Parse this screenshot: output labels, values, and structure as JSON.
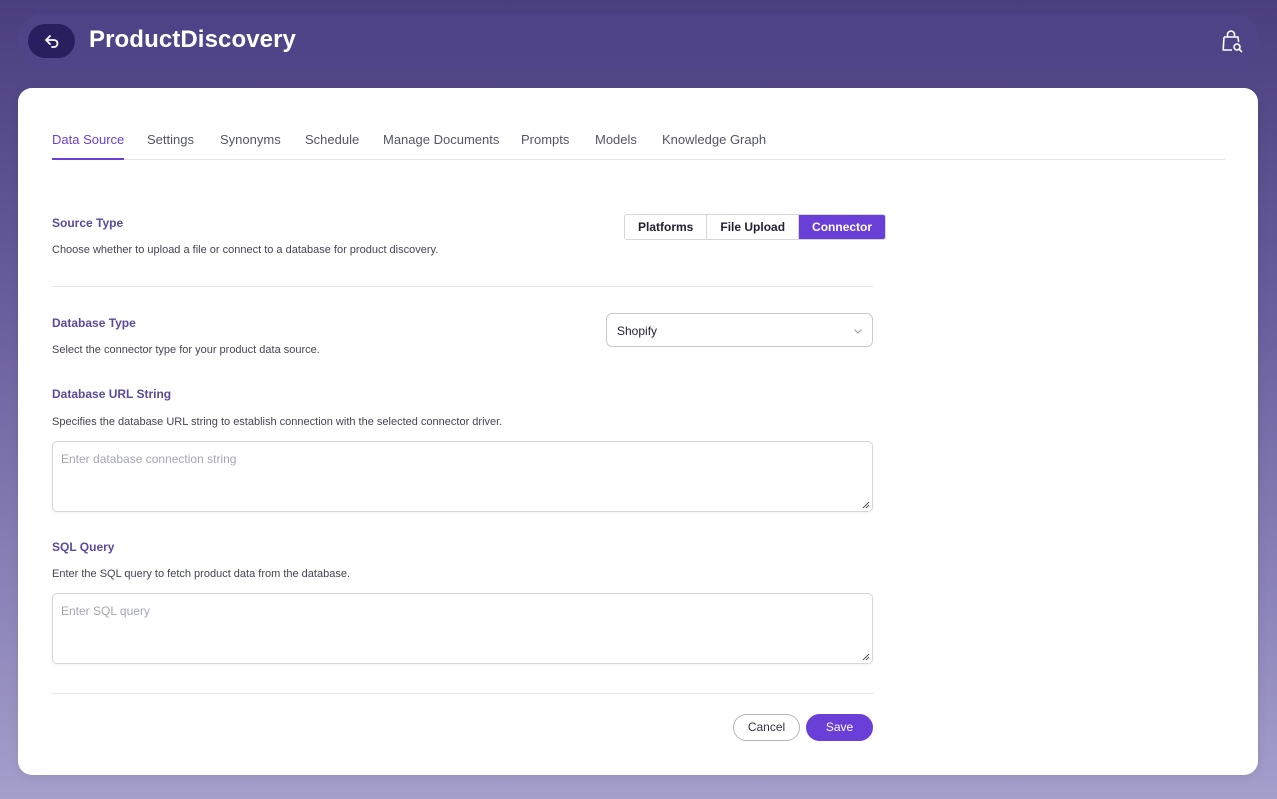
{
  "header": {
    "title": "ProductDiscovery",
    "back_icon": "undo-arrow-icon",
    "right_icon": "shopping-bag-search-icon"
  },
  "tabs": [
    {
      "label": "Data Source",
      "active": true
    },
    {
      "label": "Settings",
      "active": false
    },
    {
      "label": "Synonyms",
      "active": false
    },
    {
      "label": "Schedule",
      "active": false
    },
    {
      "label": "Manage Documents",
      "active": false
    },
    {
      "label": "Prompts",
      "active": false
    },
    {
      "label": "Models",
      "active": false
    },
    {
      "label": "Knowledge Graph",
      "active": false
    }
  ],
  "source_type": {
    "title": "Source Type",
    "description": "Choose whether to upload a file or connect to a database for product discovery.",
    "options": [
      "Platforms",
      "File Upload",
      "Connector"
    ],
    "selected": "Connector"
  },
  "database_type": {
    "title": "Database Type",
    "description": "Select the connector type for your product data source.",
    "value": "Shopify"
  },
  "database_url": {
    "title": "Database URL String",
    "description": "Specifies the database URL string to establish connection with the selected connector driver.",
    "placeholder": "Enter database connection string",
    "value": ""
  },
  "sql_query": {
    "title": "SQL Query",
    "description": "Enter the SQL query to fetch product data from the database.",
    "placeholder": "Enter SQL query",
    "value": ""
  },
  "actions": {
    "cancel_label": "Cancel",
    "save_label": "Save"
  },
  "colors": {
    "accent": "#6a3fd8",
    "header_dark": "#2a1f5e",
    "section_title": "#5a4a9a"
  }
}
